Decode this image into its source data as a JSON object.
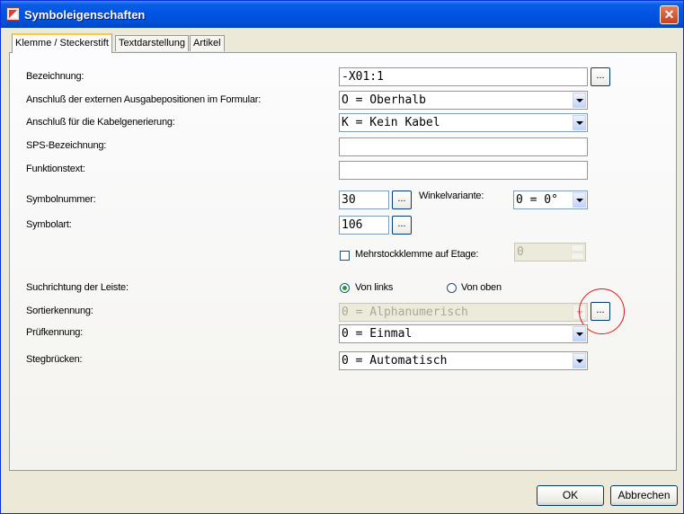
{
  "window": {
    "title": "Symboleigenschaften",
    "close_label": "✕"
  },
  "tabs": [
    {
      "label": "Klemme / Steckerstift",
      "active": true
    },
    {
      "label": "Textdarstellung",
      "active": false
    },
    {
      "label": "Artikel",
      "active": false
    }
  ],
  "form": {
    "bezeichnung": {
      "label": "Bezeichnung:",
      "value": "-X01:1",
      "button": "..."
    },
    "anschluss_ausgabe": {
      "label": "Anschluß der externen Ausgabepositionen im Formular:",
      "value": "O = Oberhalb"
    },
    "anschluss_kabel": {
      "label": "Anschluß für die Kabelgenerierung:",
      "value": "K = Kein Kabel"
    },
    "sps": {
      "label": "SPS-Bezeichnung:",
      "value": ""
    },
    "funktionstext": {
      "label": "Funktionstext:",
      "value": ""
    },
    "symbolnummer": {
      "label": "Symbolnummer:",
      "value": "30",
      "button": "..."
    },
    "winkelvariante": {
      "label": "Winkelvariante:",
      "value": "0 = 0°"
    },
    "symbolart": {
      "label": "Symbolart:",
      "value": "106",
      "button": "..."
    },
    "mehrstock": {
      "label": "Mehrstockklemme auf Etage:",
      "checked": false,
      "spin_value": "0"
    },
    "suchrichtung": {
      "label": "Suchrichtung der Leiste:",
      "options": [
        "Von links",
        "Von oben"
      ],
      "selected": "Von links"
    },
    "sortierkennung": {
      "label": "Sortierkennung:",
      "value": "0 = Alphanumerisch",
      "button": "...",
      "disabled": true
    },
    "pruefkennung": {
      "label": "Prüfkennung:",
      "value": "0 = Einmal"
    },
    "stegbruecken": {
      "label": "Stegbrücken:",
      "value": "0 = Automatisch"
    }
  },
  "footer": {
    "ok": "OK",
    "cancel": "Abbrechen"
  },
  "colors": {
    "titlebar": "#0054e3",
    "dialog_bg": "#ece9d8",
    "highlight_circle": "#d81818"
  }
}
